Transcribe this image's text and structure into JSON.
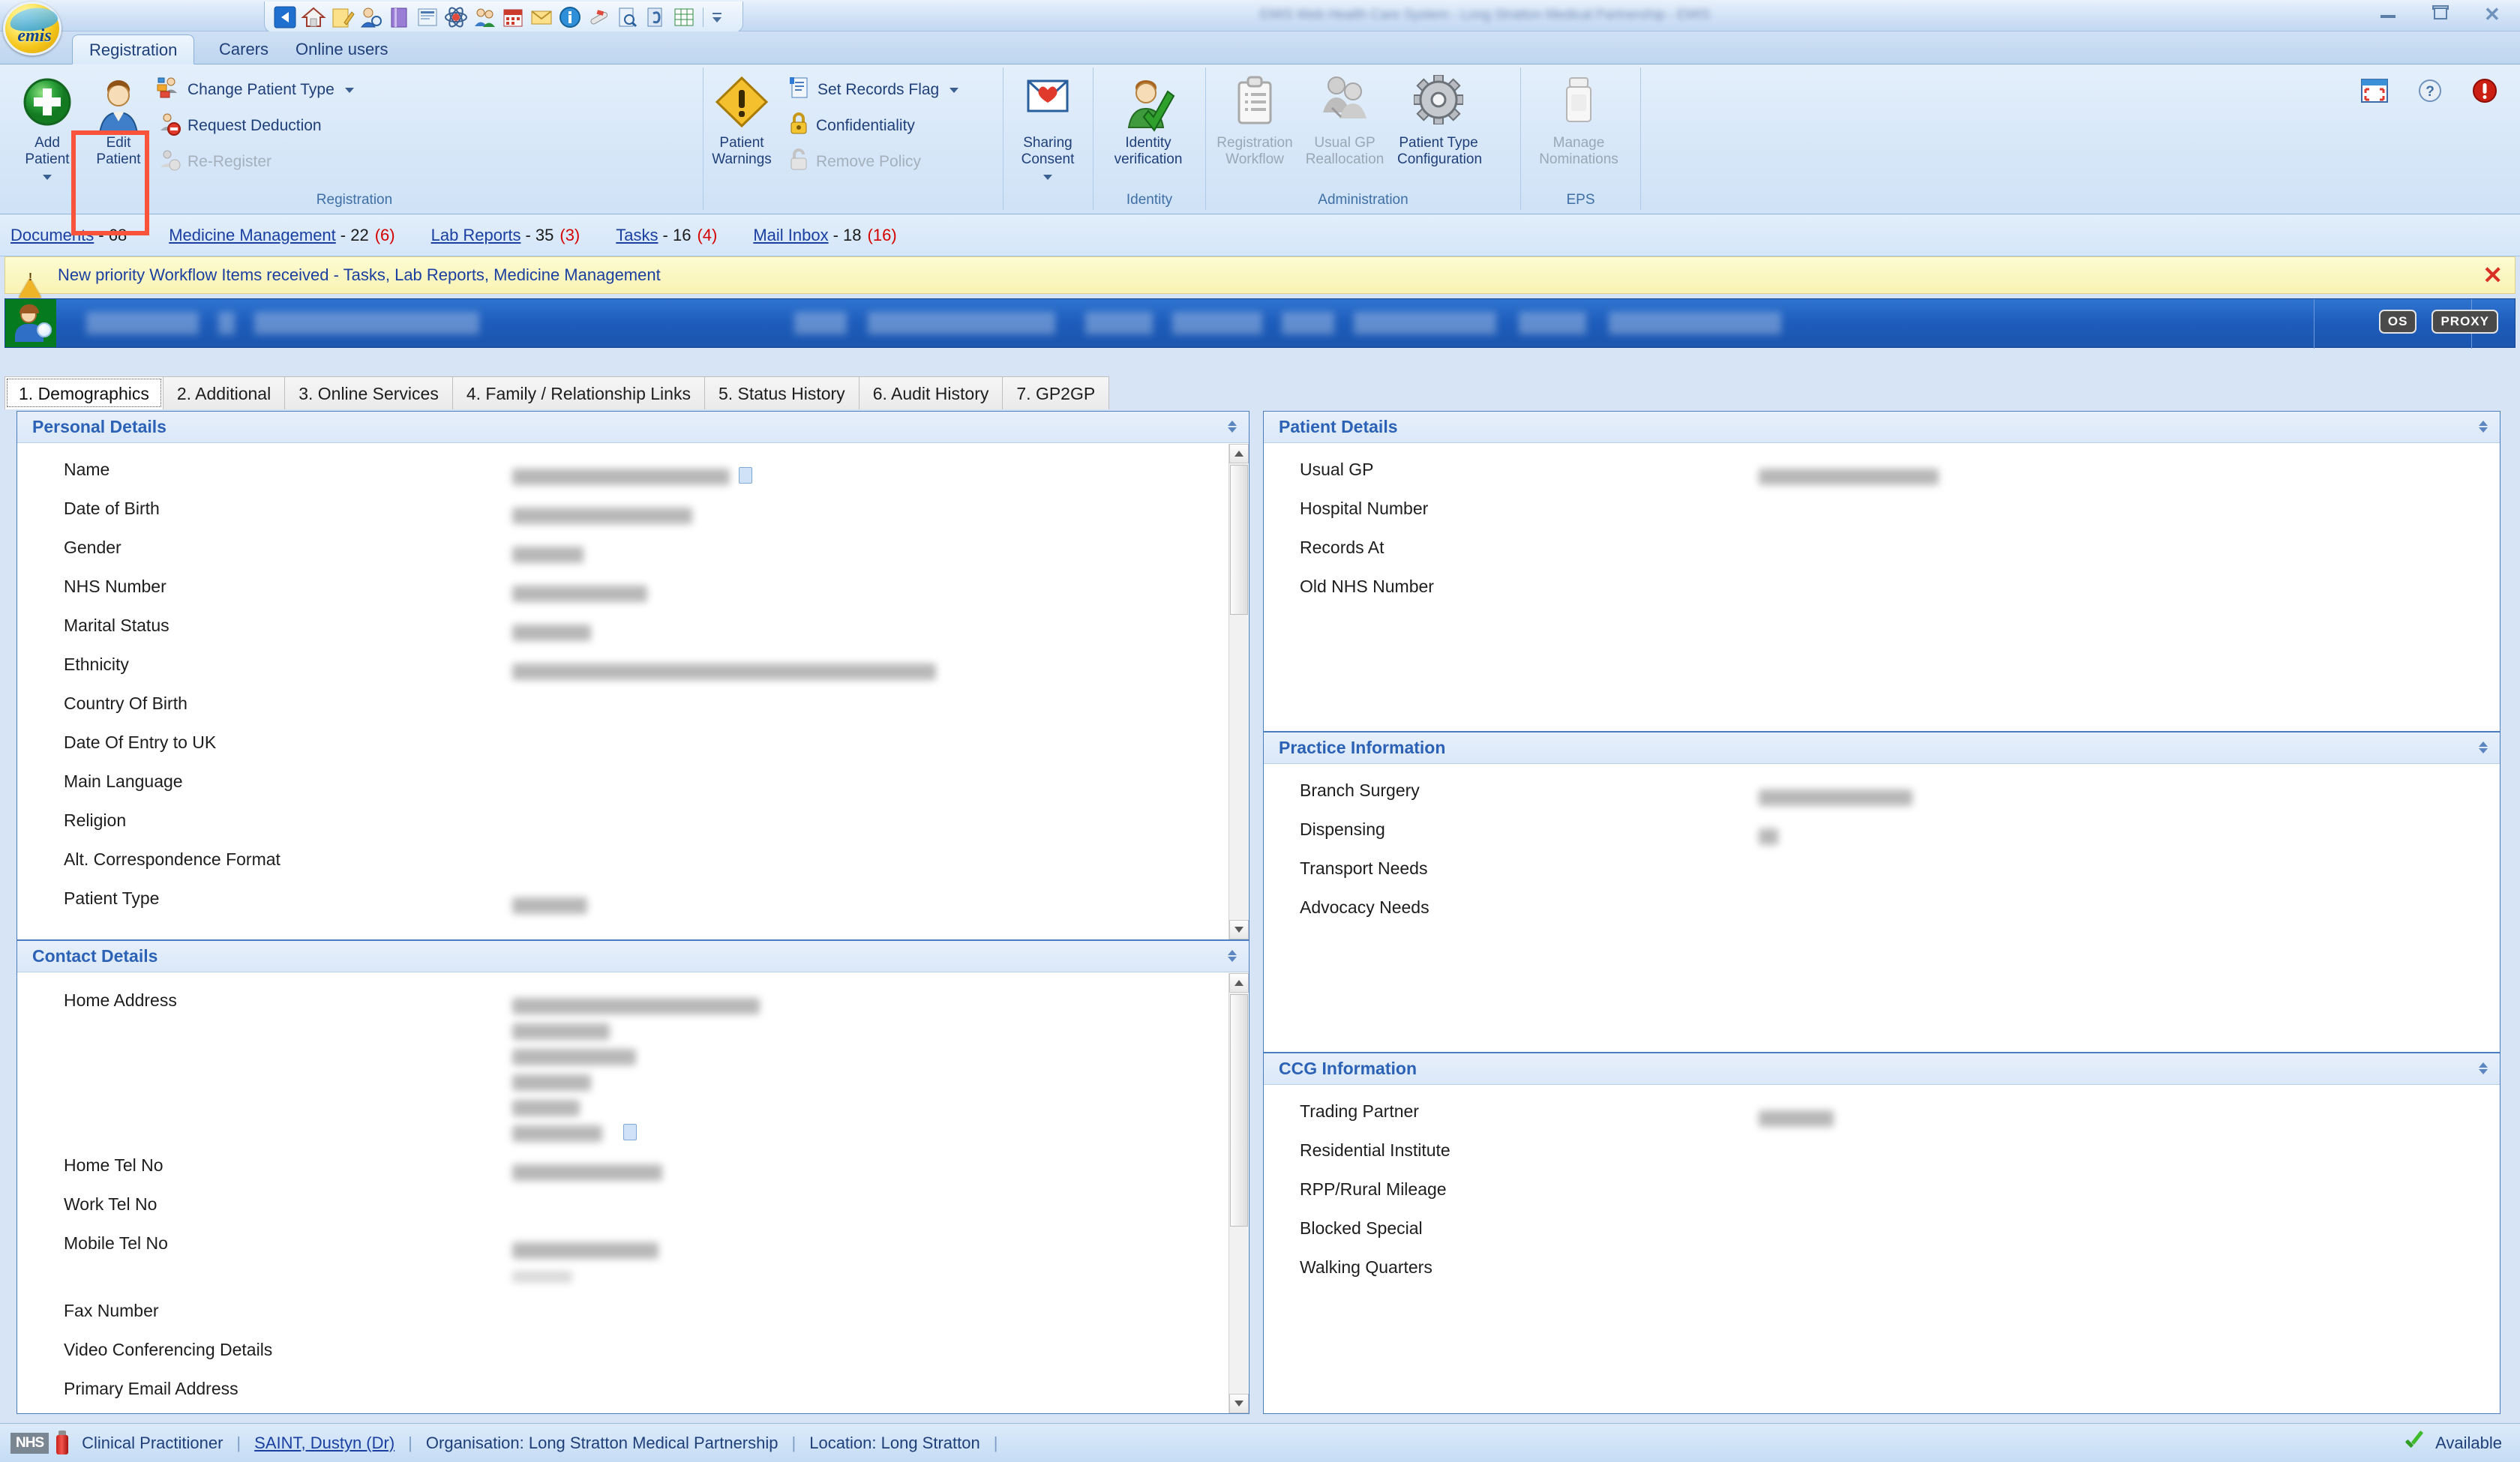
{
  "window": {
    "title": "EMIS Web Health Care System - Long Stratton Medical Partnership - EMIS",
    "minimize_label": "Minimize",
    "restore_label": "Restore",
    "close_label": "Close"
  },
  "brand": {
    "logo_text": "emis"
  },
  "quick_access": {
    "items": [
      {
        "name": "back-icon"
      },
      {
        "name": "home-icon"
      },
      {
        "name": "edit-note-icon"
      },
      {
        "name": "patient-search-icon"
      },
      {
        "name": "book-icon"
      },
      {
        "name": "print-preview-icon"
      },
      {
        "name": "network-icon"
      },
      {
        "name": "users-icon"
      },
      {
        "name": "calendar-icon"
      },
      {
        "name": "mail-icon"
      },
      {
        "name": "info-icon"
      },
      {
        "name": "prescription-icon"
      },
      {
        "name": "find-document-icon"
      },
      {
        "name": "attach-icon"
      },
      {
        "name": "grid-icon"
      }
    ],
    "overflow_label": "More"
  },
  "ribbon": {
    "tabs": [
      {
        "label": "Registration",
        "active": true
      },
      {
        "label": "Carers",
        "active": false
      },
      {
        "label": "Online users",
        "active": false
      }
    ],
    "groups": [
      {
        "title": "Registration",
        "big_buttons": [
          {
            "label": "Add\nPatient",
            "name": "add-patient-button",
            "enabled": true,
            "has_caret": true,
            "icon": "add-patient-icon"
          },
          {
            "label": "Edit\nPatient",
            "name": "edit-patient-button",
            "enabled": true,
            "has_caret": false,
            "icon": "edit-patient-icon",
            "highlighted": true
          }
        ],
        "small_buttons": [
          {
            "label": "Change Patient Type",
            "name": "change-patient-type-button",
            "enabled": true,
            "has_caret": true,
            "icon": "change-patient-type-icon"
          },
          {
            "label": "Request Deduction",
            "name": "request-deduction-button",
            "enabled": true,
            "has_caret": false,
            "icon": "request-deduction-icon"
          },
          {
            "label": "Re-Register",
            "name": "re-register-button",
            "enabled": false,
            "has_caret": false,
            "icon": "re-register-icon"
          }
        ]
      },
      {
        "title": "",
        "big_buttons": [
          {
            "label": "Patient\nWarnings",
            "name": "patient-warnings-button",
            "enabled": true,
            "has_caret": false,
            "icon": "warning-triangle-icon"
          }
        ],
        "small_buttons": [
          {
            "label": "Set Records Flag",
            "name": "set-records-flag-button",
            "enabled": true,
            "has_caret": true,
            "icon": "records-flag-icon"
          },
          {
            "label": "Confidentiality",
            "name": "confidentiality-button",
            "enabled": true,
            "has_caret": false,
            "icon": "padlock-icon"
          },
          {
            "label": "Remove Policy",
            "name": "remove-policy-button",
            "enabled": false,
            "has_caret": false,
            "icon": "remove-policy-icon"
          }
        ]
      },
      {
        "title": "",
        "big_buttons": [
          {
            "label": "Sharing\nConsent",
            "name": "sharing-consent-button",
            "enabled": true,
            "has_caret": true,
            "icon": "envelope-heart-icon"
          }
        ],
        "small_buttons": []
      },
      {
        "title": "Identity",
        "big_buttons": [
          {
            "label": "Identity\nverification",
            "name": "identity-verification-button",
            "enabled": true,
            "has_caret": false,
            "icon": "identity-verified-icon"
          }
        ],
        "small_buttons": []
      },
      {
        "title": "Administration",
        "big_buttons": [
          {
            "label": "Registration\nWorkflow",
            "name": "registration-workflow-button",
            "enabled": false,
            "has_caret": false,
            "icon": "clipboard-icon"
          },
          {
            "label": "Usual GP\nReallocation",
            "name": "usual-gp-reallocation-button",
            "enabled": false,
            "has_caret": false,
            "icon": "two-people-icon"
          },
          {
            "label": "Patient Type\nConfiguration",
            "name": "patient-type-configuration-button",
            "enabled": true,
            "has_caret": false,
            "icon": "gear-icon"
          }
        ],
        "small_buttons": []
      },
      {
        "title": "EPS",
        "big_buttons": [
          {
            "label": "Manage\nNominations",
            "name": "manage-nominations-button",
            "enabled": false,
            "has_caret": false,
            "icon": "pill-bottle-icon"
          }
        ],
        "small_buttons": []
      }
    ]
  },
  "workflow_bar": {
    "items": [
      {
        "label": "Documents",
        "count": "- 68",
        "urgent": ""
      },
      {
        "label": "Medicine Management",
        "count": "- 22",
        "urgent": "(6)"
      },
      {
        "label": "Lab Reports",
        "count": "- 35",
        "urgent": "(3)"
      },
      {
        "label": "Tasks",
        "count": "- 16",
        "urgent": "(4)"
      },
      {
        "label": "Mail Inbox",
        "count": "- 18",
        "urgent": "(16)"
      }
    ]
  },
  "alert": {
    "message": "New priority Workflow Items received - Tasks, Lab Reports, Medicine Management",
    "close_label": "✕"
  },
  "patient_banner": {
    "badges": [
      "OS",
      "PROXY"
    ],
    "redacted_fields": 7
  },
  "content_tabs": [
    {
      "label": "1. Demographics",
      "active": true
    },
    {
      "label": "2. Additional",
      "active": false
    },
    {
      "label": "3. Online Services",
      "active": false
    },
    {
      "label": "4. Family / Relationship Links",
      "active": false
    },
    {
      "label": "5. Status History",
      "active": false
    },
    {
      "label": "6. Audit History",
      "active": false
    },
    {
      "label": "7. GP2GP",
      "active": false
    }
  ],
  "panels": {
    "personal_details": {
      "title": "Personal Details",
      "fields": [
        {
          "label": "Name",
          "redacted": true,
          "value_width": 290,
          "chip": true
        },
        {
          "label": "Date of Birth",
          "redacted": true,
          "value_width": 240,
          "chip": false
        },
        {
          "label": "Gender",
          "redacted": true,
          "value_width": 95,
          "chip": false
        },
        {
          "label": "NHS Number",
          "redacted": true,
          "value_width": 180,
          "chip": false
        },
        {
          "label": "Marital Status",
          "redacted": true,
          "value_width": 105,
          "chip": false
        },
        {
          "label": "Ethnicity",
          "redacted": true,
          "value_width": 565,
          "chip": false
        },
        {
          "label": "Country Of Birth",
          "redacted": false,
          "value_width": 0,
          "chip": false
        },
        {
          "label": "Date Of Entry to UK",
          "redacted": false,
          "value_width": 0,
          "chip": false
        },
        {
          "label": "Main Language",
          "redacted": false,
          "value_width": 0,
          "chip": false
        },
        {
          "label": "Religion",
          "redacted": false,
          "value_width": 0,
          "chip": false
        },
        {
          "label": "Alt. Correspondence Format",
          "redacted": false,
          "value_width": 0,
          "chip": false
        },
        {
          "label": "Patient Type",
          "redacted": true,
          "value_width": 100,
          "chip": false
        }
      ]
    },
    "contact_details": {
      "title": "Contact Details",
      "fields": [
        {
          "label": "Home Address",
          "redacted": true,
          "value_width": 330,
          "chip": false,
          "lines": 6
        },
        {
          "label": "Home Tel No",
          "redacted": true,
          "value_width": 200,
          "chip": false,
          "lines": 1
        },
        {
          "label": "Work Tel No",
          "redacted": false,
          "value_width": 0,
          "chip": false,
          "lines": 0
        },
        {
          "label": "Mobile Tel No",
          "redacted": true,
          "value_width": 195,
          "chip": false,
          "lines": 2
        },
        {
          "label": "Fax Number",
          "redacted": false,
          "value_width": 0,
          "chip": false,
          "lines": 0
        },
        {
          "label": "Video Conferencing Details",
          "redacted": false,
          "value_width": 0,
          "chip": false,
          "lines": 0
        },
        {
          "label": "Primary Email Address",
          "redacted": false,
          "value_width": 0,
          "chip": false,
          "lines": 0
        }
      ]
    },
    "patient_details": {
      "title": "Patient Details",
      "fields": [
        {
          "label": "Usual GP",
          "redacted": true,
          "value_width": 240
        },
        {
          "label": "Hospital Number",
          "redacted": false,
          "value_width": 0
        },
        {
          "label": "Records At",
          "redacted": false,
          "value_width": 0
        },
        {
          "label": "Old NHS Number",
          "redacted": false,
          "value_width": 0
        }
      ]
    },
    "practice_information": {
      "title": "Practice Information",
      "fields": [
        {
          "label": "Branch Surgery",
          "redacted": true,
          "value_width": 205
        },
        {
          "label": "Dispensing",
          "redacted": true,
          "value_width": 26
        },
        {
          "label": "Transport Needs",
          "redacted": false,
          "value_width": 0
        },
        {
          "label": "Advocacy Needs",
          "redacted": false,
          "value_width": 0
        }
      ]
    },
    "ccg_information": {
      "title": "CCG Information",
      "fields": [
        {
          "label": "Trading Partner",
          "redacted": true,
          "value_width": 100
        },
        {
          "label": "Residential Institute",
          "redacted": false,
          "value_width": 0
        },
        {
          "label": "RPP/Rural Mileage",
          "redacted": false,
          "value_width": 0
        },
        {
          "label": "Blocked Special",
          "redacted": false,
          "value_width": 0
        },
        {
          "label": "Walking Quarters",
          "redacted": false,
          "value_width": 0
        }
      ]
    }
  },
  "status_bar": {
    "nhs_label": "NHS",
    "role": "Clinical Practitioner",
    "user": "SAINT, Dustyn (Dr)",
    "organisation": "Organisation: Long Stratton Medical Partnership",
    "location": "Location:  Long Stratton",
    "availability": "Available"
  },
  "colors": {
    "accent_blue": "#2c62b5",
    "link_blue": "#1a3fa0",
    "urgent_red": "#d40000",
    "highlight_red": "#f9533c",
    "banner_blue": "#1d5cbb",
    "panel_border": "#4a7cc0"
  }
}
